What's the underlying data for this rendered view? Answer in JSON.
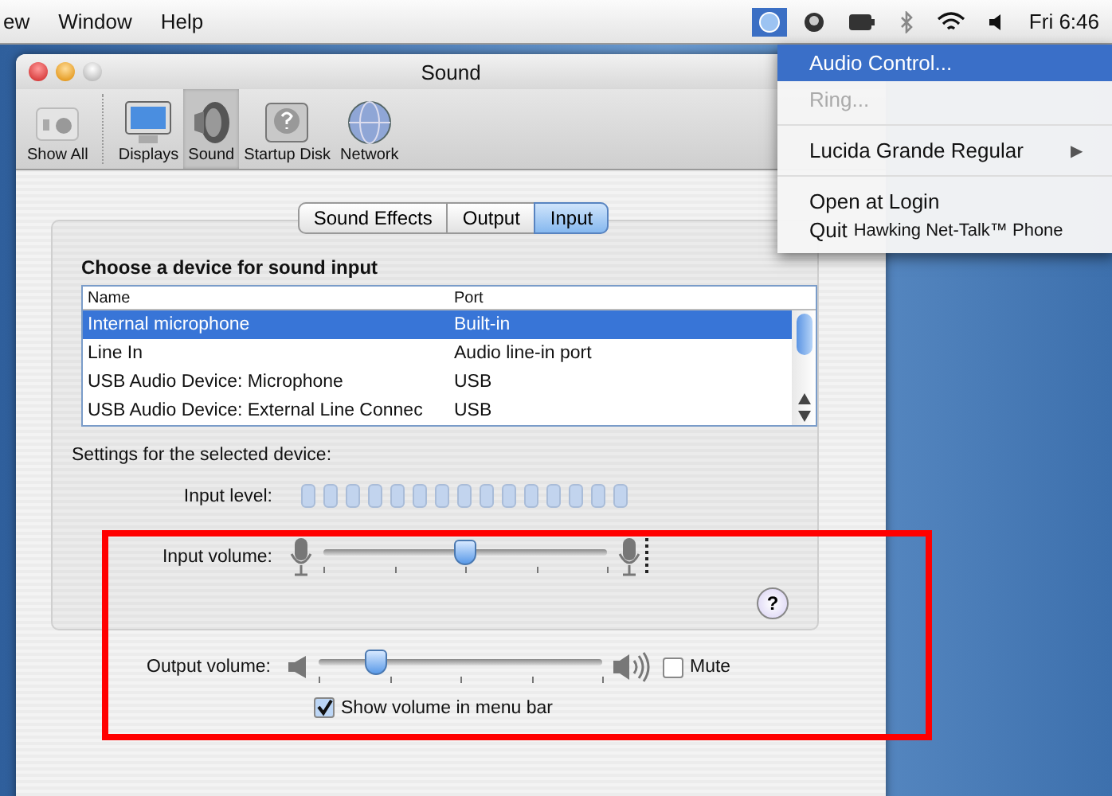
{
  "menu_bar": {
    "menus": [
      "ew",
      "Window",
      "Help"
    ],
    "clock": "Fri 6:46"
  },
  "status_menu": {
    "items": [
      {
        "kind": "item",
        "label": "Audio Control...",
        "selected": true,
        "disabled": false
      },
      {
        "kind": "item",
        "label": "Ring...",
        "selected": false,
        "disabled": true
      },
      {
        "kind": "submenu",
        "label": "Lucida Grande Regular",
        "arrow": "▶",
        "selected": false,
        "disabled": false
      },
      {
        "kind": "item",
        "label": "Open at Login",
        "selected": false,
        "disabled": false
      },
      {
        "kind": "quit",
        "label": "Quit",
        "app_name": "Hawking Net-Talk™ Phone",
        "selected": false,
        "disabled": false
      }
    ]
  },
  "window": {
    "title": "Sound"
  },
  "toolbar": [
    {
      "kind": "showall",
      "label": "Show All",
      "selected": false
    },
    {
      "kind": "displays",
      "label": "Displays",
      "selected": false
    },
    {
      "kind": "sound",
      "label": "Sound",
      "selected": true
    },
    {
      "kind": "disk",
      "label": "Startup Disk",
      "selected": false
    },
    {
      "kind": "network",
      "label": "Network",
      "selected": false
    }
  ],
  "tabs": [
    {
      "label": "Sound Effects",
      "selected": false
    },
    {
      "label": "Output",
      "selected": false
    },
    {
      "label": "Input",
      "selected": true
    }
  ],
  "device_heading": "Choose a device for sound input",
  "table": {
    "columns": [
      "Name",
      "Port"
    ],
    "rows": [
      {
        "name": "Internal microphone",
        "port": "Built-in",
        "selected": true
      },
      {
        "name": "Line In",
        "port": "Audio line-in port",
        "selected": false
      },
      {
        "name": "USB Audio Device: Microphone",
        "port": "USB",
        "selected": false
      },
      {
        "name": "USB Audio Device: External Line Connec",
        "port": "USB",
        "selected": false
      }
    ]
  },
  "settings_label": "Settings for the selected device:",
  "input_level": {
    "label": "Input level:"
  },
  "input_volume": {
    "label": "Input volume:",
    "level": 0.5
  },
  "help": "?",
  "output_volume": {
    "label": "Output volume:",
    "level": 0.2
  },
  "mute": {
    "label": "Mute",
    "checked": false
  },
  "show_volume": {
    "label": "Show volume in menu bar",
    "checked": true
  }
}
